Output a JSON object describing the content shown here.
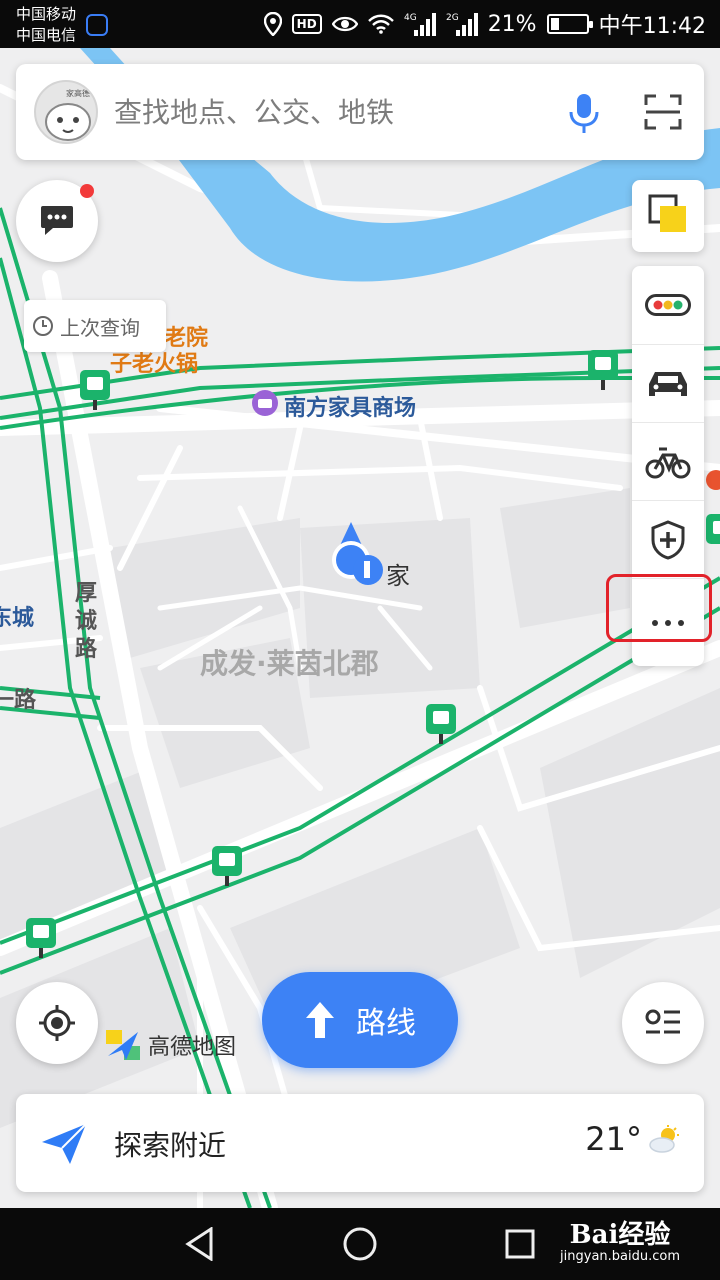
{
  "status_bar": {
    "carrier_1": "中国移动",
    "carrier_2": "中国电信",
    "hd_label": "HD",
    "signal_1_label": "4G",
    "signal_2_label": "2G",
    "battery_text": "21%",
    "battery_level": 0.21,
    "time": "中午11:42"
  },
  "search": {
    "avatar_caption": "家高德",
    "placeholder": "查找地点、公交、地铁"
  },
  "last_query": {
    "label": "上次查询"
  },
  "map_labels": {
    "poi_1a": "老院",
    "poi_1b": "子老火锅",
    "poi_mall": "南方家具商场",
    "home": "家",
    "area": "成发·莱茵北郡",
    "road_1": "厚诚路",
    "road_2a": "东城",
    "road_2b": "一路"
  },
  "route_button": {
    "label": "路线"
  },
  "logo": {
    "text": "高德地图"
  },
  "explore": {
    "label": "探索附近",
    "temperature": "21°"
  },
  "watermark": {
    "brand": "Bai经验",
    "url": "jingyan.baidu.com"
  },
  "icons": {
    "message": "chat-bubble-icon",
    "layers": "layers-icon",
    "traffic": "traffic-light-icon",
    "taxi": "car-icon",
    "bike": "bicycle-icon",
    "safety": "shield-plus-icon",
    "more": "more-dots-icon"
  },
  "colors": {
    "accent": "#3d82f5",
    "route_green": "#1bb36b",
    "river": "#7cc4f4",
    "highlight": "#e2222a"
  }
}
